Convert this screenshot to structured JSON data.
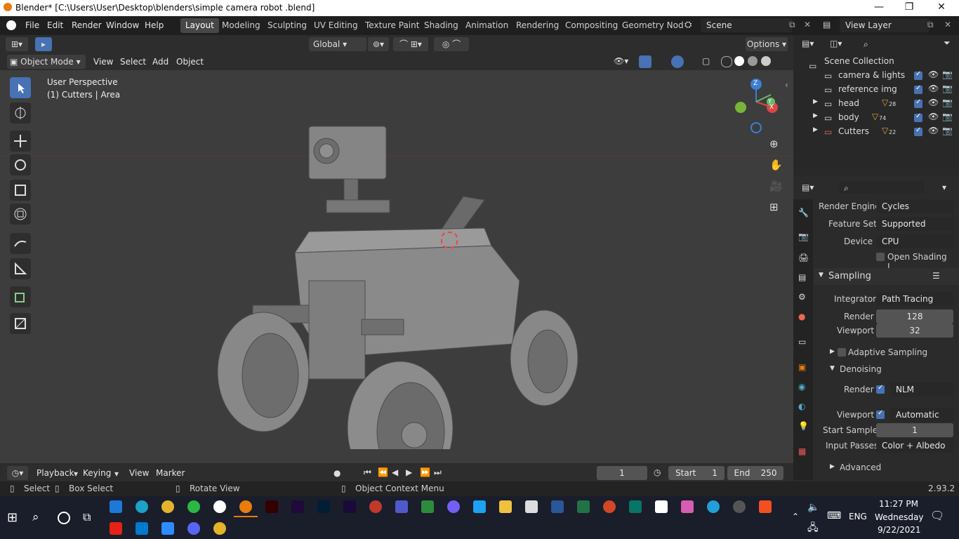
{
  "window": {
    "title": "Blender* [C:\\Users\\User\\Desktop\\blenders\\simple camera robot .blend]",
    "minimize": "—",
    "maximize": "❐",
    "close": "✕"
  },
  "menu": {
    "items": [
      "File",
      "Edit",
      "Render",
      "Window",
      "Help"
    ]
  },
  "workspaces": [
    "Layout",
    "Modeling",
    "Sculpting",
    "UV Editing",
    "Texture Paint",
    "Shading",
    "Animation",
    "Rendering",
    "Compositing",
    "Geometry Nod"
  ],
  "active_workspace": "Layout",
  "scene": {
    "name": "Scene",
    "view_layer": "View Layer"
  },
  "tool_header": {
    "orientation": "Global",
    "options": "Options"
  },
  "viewport_header": {
    "mode": "Object Mode",
    "menus": [
      "View",
      "Select",
      "Add",
      "Object"
    ]
  },
  "viewport": {
    "perspective": "User Perspective",
    "collection_info": "(1) Cutters | Area",
    "gizmo_x": "X",
    "gizmo_y": "Y",
    "gizmo_z": "Z"
  },
  "outliner": {
    "root": "Scene Collection",
    "items": [
      {
        "name": "camera & lights",
        "badge": ""
      },
      {
        "name": "reference img",
        "badge": ""
      },
      {
        "name": "head",
        "badge": "28"
      },
      {
        "name": "body",
        "badge": "74"
      },
      {
        "name": "Cutters",
        "badge": "22"
      }
    ]
  },
  "properties": {
    "render_engine_label": "Render Engine",
    "render_engine": "Cycles",
    "feature_set_label": "Feature Set",
    "feature_set": "Supported",
    "device_label": "Device",
    "device": "CPU",
    "open_shading": "Open Shading L...",
    "sampling": "Sampling",
    "integrator_label": "Integrator",
    "integrator": "Path Tracing",
    "render_label": "Render",
    "render_samples": "128",
    "viewport_label": "Viewport",
    "viewport_samples": "32",
    "adaptive_sampling": "Adaptive Sampling",
    "denoising": "Denoising",
    "denoise_render_label": "Render",
    "denoise_render": "NLM",
    "denoise_viewport_label": "Viewport",
    "denoise_viewport": "Automatic",
    "start_sample_label": "Start Sample",
    "start_sample": "1",
    "input_passes_label": "Input Passes",
    "input_passes": "Color + Albedo",
    "advanced": "Advanced"
  },
  "timeline": {
    "playback": "Playback",
    "keying": "Keying",
    "view": "View",
    "marker": "Marker",
    "current_frame": "1",
    "start_label": "Start",
    "start": "1",
    "end_label": "End",
    "end": "250"
  },
  "status": {
    "select": "Select",
    "box_select": "Box Select",
    "rotate_view": "Rotate View",
    "context_menu": "Object Context Menu",
    "version": "2.93.2"
  },
  "taskbar": {
    "time": "11:27 PM",
    "day": "Wednesday",
    "date": "9/22/2021",
    "lang": "ENG"
  },
  "colors": {
    "accent": "#4772b3",
    "viewport_bg": "#3d3d3d",
    "panel_bg": "#2b2b2b",
    "taskbar": "#1a1d2a"
  }
}
